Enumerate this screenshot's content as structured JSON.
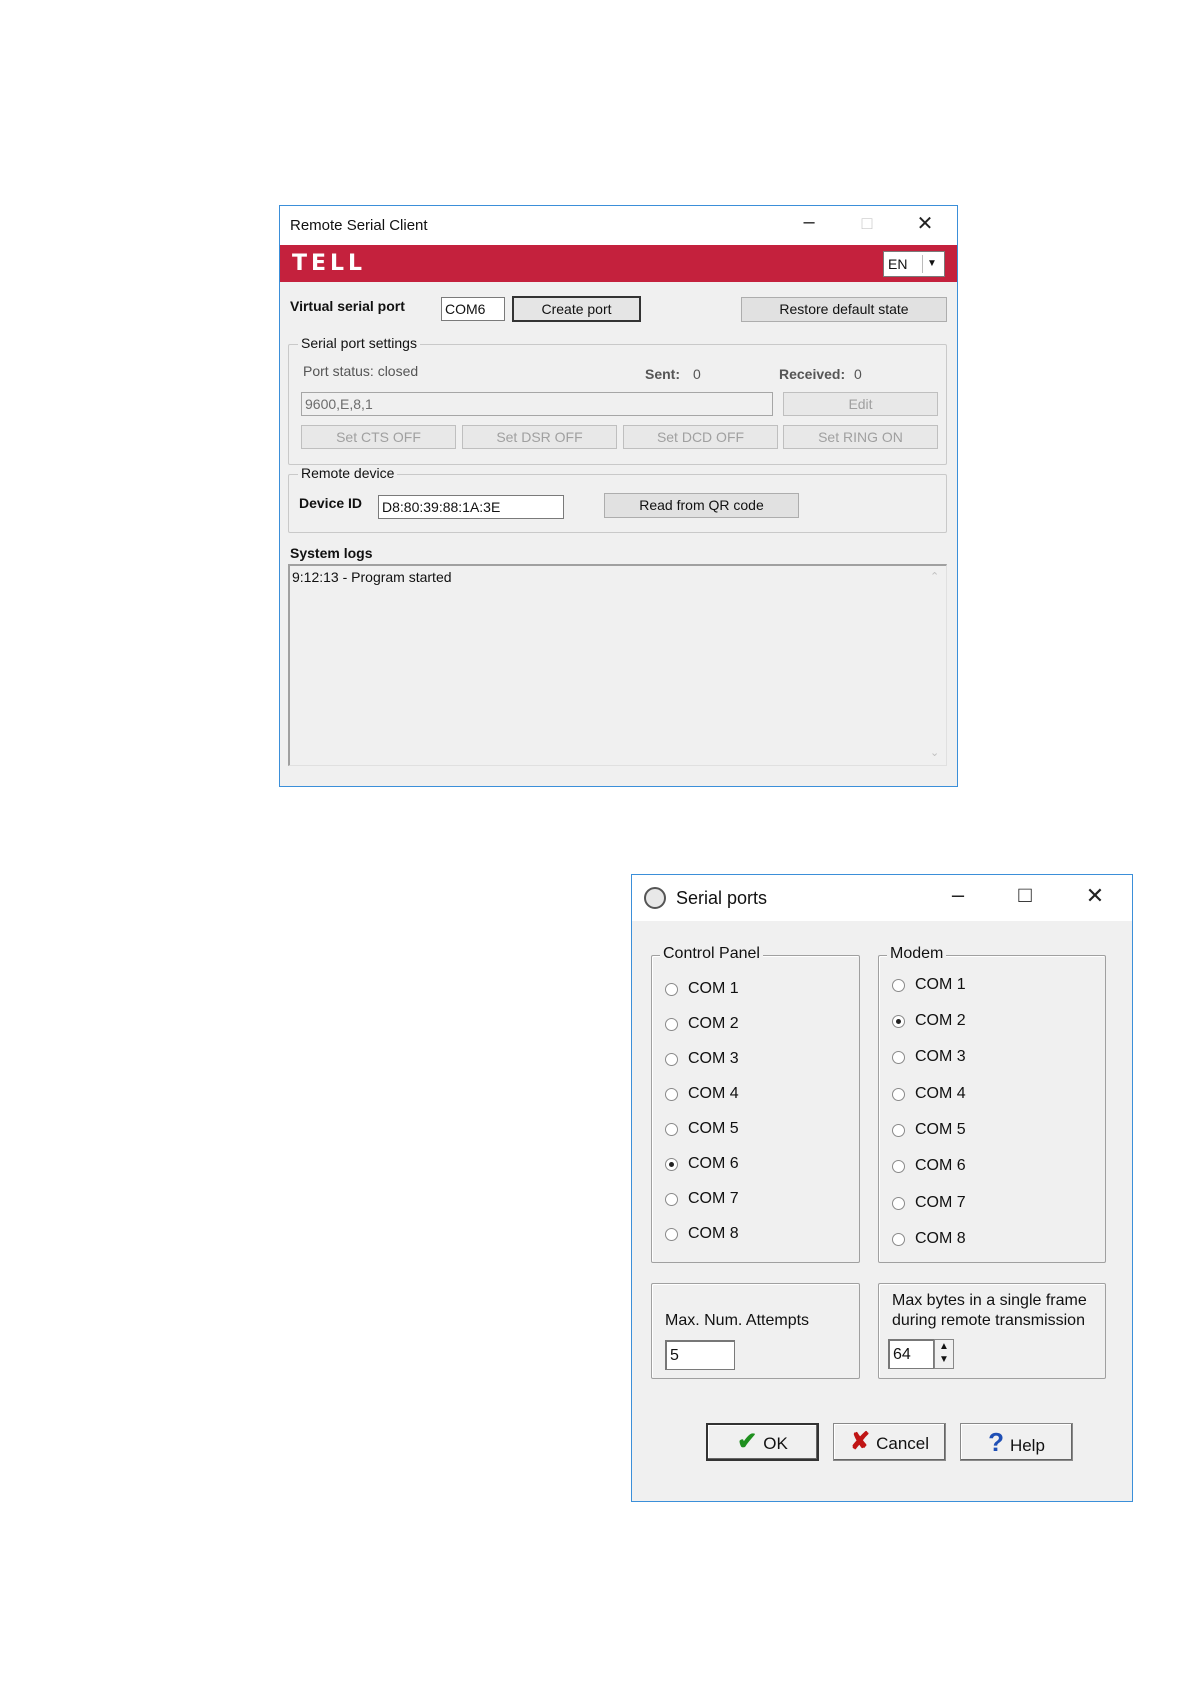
{
  "remote_client": {
    "title": "Remote Serial Client",
    "logo_text": "TELL",
    "language": "EN",
    "virtual_serial_port_label": "Virtual serial port",
    "virtual_serial_port_value": "COM6",
    "create_port_label": "Create port",
    "restore_default_label": "Restore default state",
    "serial_settings": {
      "title": "Serial port settings",
      "port_status": "Port status: closed",
      "sent_label": "Sent:",
      "sent_value": "0",
      "received_label": "Received:",
      "received_value": "0",
      "settings_value": "9600,E,8,1",
      "edit_label": "Edit",
      "set_cts_label": "Set CTS OFF",
      "set_dsr_label": "Set DSR OFF",
      "set_dcd_label": "Set DCD OFF",
      "set_ring_label": "Set RING ON"
    },
    "remote_device": {
      "title": "Remote device",
      "device_id_label": "Device ID",
      "device_id_value": "D8:80:39:88:1A:3E",
      "read_qr_label": "Read from QR code"
    },
    "system_logs": {
      "title": "System logs",
      "entries": [
        "9:12:13 - Program started"
      ]
    },
    "accent_color": "#c4213d"
  },
  "serial_ports": {
    "title": "Serial ports",
    "control_panel": {
      "title": "Control Panel",
      "options": [
        "COM 1",
        "COM 2",
        "COM 3",
        "COM 4",
        "COM 5",
        "COM 6",
        "COM 7",
        "COM 8"
      ],
      "selected": "COM 6"
    },
    "modem": {
      "title": "Modem",
      "options": [
        "COM 1",
        "COM 2",
        "COM 3",
        "COM 4",
        "COM 5",
        "COM 6",
        "COM 7",
        "COM 8"
      ],
      "selected": "COM 2"
    },
    "max_attempts_label": "Max. Num. Attempts",
    "max_attempts_value": "5",
    "max_bytes_label_line1": "Max bytes in a single frame",
    "max_bytes_label_line2": "during remote transmission",
    "max_bytes_value": "64",
    "ok_label": "OK",
    "cancel_label": "Cancel",
    "help_label": "Help"
  }
}
